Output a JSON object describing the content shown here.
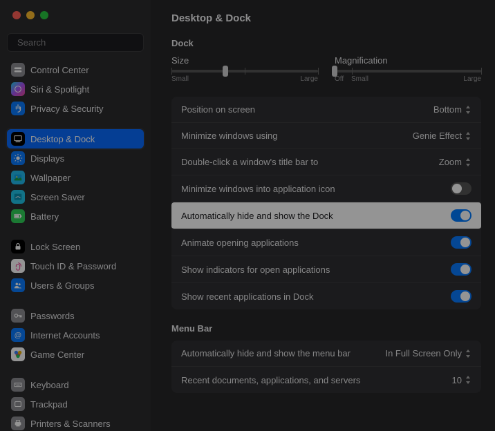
{
  "search": {
    "placeholder": "Search"
  },
  "sidebar": {
    "groups": [
      [
        {
          "label": "Control Center",
          "iconBg": "#8e8e93",
          "glyph": "cc"
        },
        {
          "label": "Siri & Spotlight",
          "iconBg": "linear-gradient(135deg,#22d3ee,#a855f7,#ec4899)",
          "glyph": "siri"
        },
        {
          "label": "Privacy & Security",
          "iconBg": "#0a7aff",
          "glyph": "hand"
        }
      ],
      [
        {
          "label": "Desktop & Dock",
          "iconBg": "#000000",
          "glyph": "dock",
          "selected": true
        },
        {
          "label": "Displays",
          "iconBg": "#0a7aff",
          "glyph": "sun"
        },
        {
          "label": "Wallpaper",
          "iconBg": "#22bcef",
          "glyph": "wall"
        },
        {
          "label": "Screen Saver",
          "iconBg": "#20c4e8",
          "glyph": "ss"
        },
        {
          "label": "Battery",
          "iconBg": "#30d158",
          "glyph": "batt"
        }
      ],
      [
        {
          "label": "Lock Screen",
          "iconBg": "#000000",
          "glyph": "lock"
        },
        {
          "label": "Touch ID & Password",
          "iconBg": "#ffffff",
          "glyph": "touch"
        },
        {
          "label": "Users & Groups",
          "iconBg": "#0a7aff",
          "glyph": "users"
        }
      ],
      [
        {
          "label": "Passwords",
          "iconBg": "#8e8e93",
          "glyph": "key"
        },
        {
          "label": "Internet Accounts",
          "iconBg": "#0a7aff",
          "glyph": "at"
        },
        {
          "label": "Game Center",
          "iconBg": "#ffffff",
          "glyph": "game"
        }
      ],
      [
        {
          "label": "Keyboard",
          "iconBg": "#8e8e93",
          "glyph": "kbd"
        },
        {
          "label": "Trackpad",
          "iconBg": "#8e8e93",
          "glyph": "tp"
        },
        {
          "label": "Printers & Scanners",
          "iconBg": "#8e8e93",
          "glyph": "print"
        }
      ]
    ]
  },
  "main": {
    "title": "Desktop & Dock",
    "dock": {
      "heading": "Dock",
      "size": {
        "label": "Size",
        "min": "Small",
        "max": "Large",
        "value": 0.37
      },
      "mag": {
        "label": "Magnification",
        "off": "Off",
        "min": "Small",
        "max": "Large",
        "value": 0.0
      },
      "rows": [
        {
          "label": "Position on screen",
          "kind": "popup",
          "value": "Bottom"
        },
        {
          "label": "Minimize windows using",
          "kind": "popup",
          "value": "Genie Effect"
        },
        {
          "label": "Double-click a window's title bar to",
          "kind": "popup",
          "value": "Zoom"
        },
        {
          "label": "Minimize windows into application icon",
          "kind": "toggle",
          "on": false
        },
        {
          "label": "Automatically hide and show the Dock",
          "kind": "toggle",
          "on": true,
          "highlight": true
        },
        {
          "label": "Animate opening applications",
          "kind": "toggle",
          "on": true
        },
        {
          "label": "Show indicators for open applications",
          "kind": "toggle",
          "on": true
        },
        {
          "label": "Show recent applications in Dock",
          "kind": "toggle",
          "on": true
        }
      ]
    },
    "menubar": {
      "heading": "Menu Bar",
      "rows": [
        {
          "label": "Automatically hide and show the menu bar",
          "kind": "popup",
          "value": "In Full Screen Only"
        },
        {
          "label": "Recent documents, applications, and servers",
          "kind": "popup",
          "value": "10"
        }
      ]
    }
  }
}
